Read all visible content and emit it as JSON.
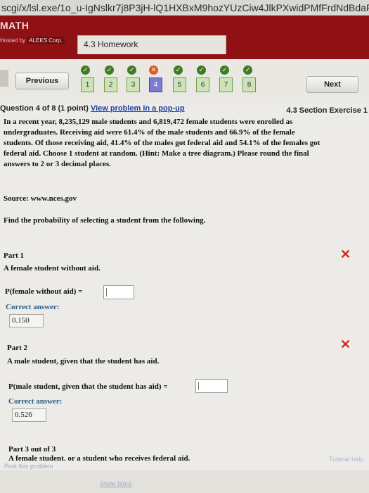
{
  "browser": {
    "url_text": "scgi/x/lsl.exe/1o_u-IgNslkr7j8P3jH-lQ1HXBxM9hozYUzCiw4JlkPXwidPMfFrdNdBdaPGXX8"
  },
  "header": {
    "brand": "MATH",
    "hosted_by": "Hosted by",
    "hosted_by_company": "ALEKS Corp.",
    "tab_label": "4.3 Homework"
  },
  "nav": {
    "previous_label": "Previous",
    "next_label": "Next",
    "questions": [
      "1",
      "2",
      "3",
      "4",
      "5",
      "6",
      "7",
      "8"
    ],
    "current": "4",
    "status": [
      "correct",
      "correct",
      "correct",
      "incorrect",
      "correct",
      "correct",
      "correct",
      "correct"
    ]
  },
  "question": {
    "counter": "Question 4 of 8 (1 point)",
    "popup_link": "View problem in a pop-up",
    "section": "4.3 Section Exercise 1",
    "problem_lines": [
      "In a recent year, 8,235,129 male students and 6,819,472 female students were enrolled as",
      "undergraduates. Receiving aid were 61.4% of the male students and 66.9% of the female",
      "students. Of those receiving aid, 41.4% of the males got federal aid and 54.1% of the females got",
      "federal aid. Choose 1 student at random. (Hint: Make a tree diagram.) Please round the final",
      "answers to 2 or 3 decimal places."
    ],
    "source": "Source: www.nces.gov",
    "instruction": "Find the probability of selecting a student from the following."
  },
  "parts": [
    {
      "title": "Part 1",
      "desc": "A female student without aid.",
      "prompt": "P(female without aid) =",
      "correct_label": "Correct answer:",
      "correct_value": "0.150"
    },
    {
      "title": "Part 2",
      "desc": "A male student, given that the student has aid.",
      "prompt": "P(male student, given that the student has aid) =",
      "correct_label": "Correct answer:",
      "correct_value": "0.526"
    },
    {
      "title": "Part 3 out of 3",
      "desc": "A female student, or a student who receives federal aid."
    }
  ],
  "footer": {
    "left_link": "Post this problem",
    "right_link": "Tutorial help",
    "show_more": "Show More"
  },
  "colors": {
    "header": "#8f1114",
    "correct_text": "#275c8a",
    "wrong_mark": "#d0281e",
    "check": "#3f7d22"
  }
}
